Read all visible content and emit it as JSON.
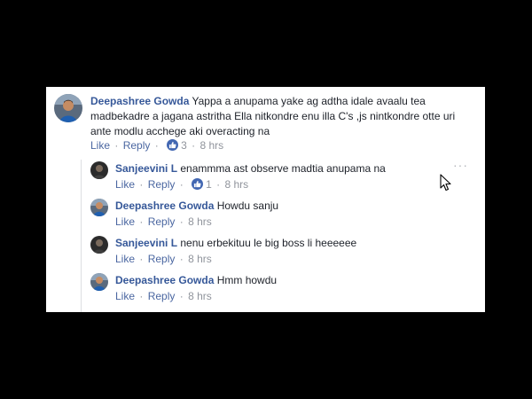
{
  "comments": {
    "main": {
      "author": "Deepashree Gowda",
      "text_line1": "Yappa a anupama yake ag adtha idale avaalu tea",
      "text_line2": "madbekadre a jagana astritha Ella nitkondre enu illa C's ,js nintkondre otte uri",
      "text_line3": "ante modlu acchege aki overacting na",
      "like_label": "Like",
      "reply_label": "Reply",
      "reaction_count": "3",
      "time": "8 hrs"
    },
    "replies": [
      {
        "author": "Sanjeevini L",
        "text": "enammma ast observe madtia anupama na",
        "like_label": "Like",
        "reply_label": "Reply",
        "reaction_count": "1",
        "time": "8 hrs"
      },
      {
        "author": "Deepashree Gowda",
        "text": "Howdu sanju",
        "like_label": "Like",
        "reply_label": "Reply",
        "time": "8 hrs"
      },
      {
        "author": "Sanjeevini L",
        "text": "nenu erbekituu le big boss li heeeeee",
        "like_label": "Like",
        "reply_label": "Reply",
        "time": "8 hrs"
      },
      {
        "author": "Deepashree Gowda",
        "text": "Hmm howdu",
        "like_label": "Like",
        "reply_label": "Reply",
        "time": "8 hrs"
      }
    ]
  },
  "more_options": "···",
  "separator": "·",
  "icons": {
    "like_reaction": "thumbs-up-icon",
    "options": "more-options-icon",
    "pointer": "mouse-cursor-icon"
  },
  "colors": {
    "author_name": "#365899",
    "action_link": "#4b67a1",
    "meta": "#90949c",
    "like_badge": "#4267b2",
    "background": "#000000",
    "panel": "#ffffff"
  }
}
